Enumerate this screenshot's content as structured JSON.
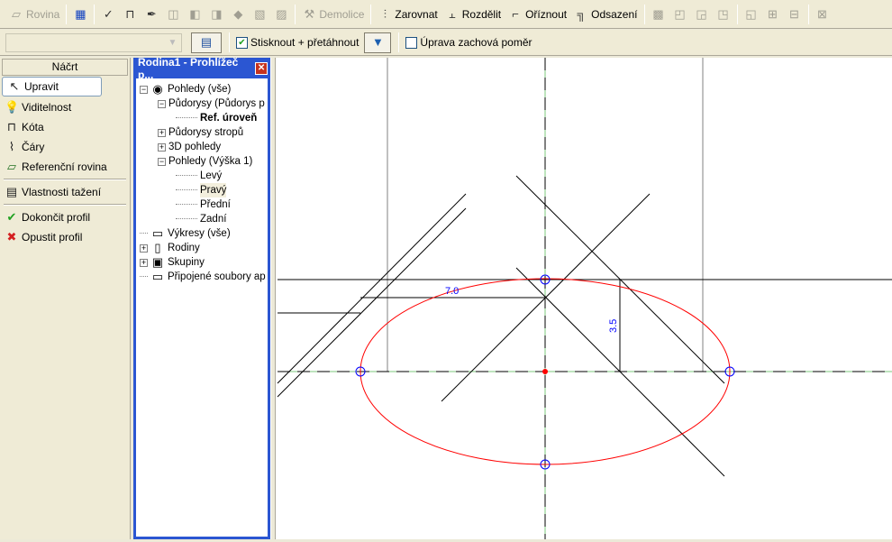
{
  "toolbar1": {
    "items": [
      {
        "label": "Rovina",
        "icon": "plane-icon",
        "disabled": true
      },
      {
        "label": "",
        "icon": "grid-icon"
      },
      {
        "label": "",
        "icon": "spellcheck-icon"
      },
      {
        "label": "",
        "icon": "dimension-icon"
      },
      {
        "label": "",
        "icon": "eyedropper-icon"
      },
      {
        "label": "",
        "icon": "cut-geometry-icon",
        "disabled": true
      },
      {
        "label": "",
        "icon": "join-icon",
        "disabled": true
      },
      {
        "label": "",
        "icon": "unjoin-icon",
        "disabled": true
      },
      {
        "label": "",
        "icon": "paint-icon",
        "disabled": true
      },
      {
        "label": "",
        "icon": "split-face-icon",
        "disabled": true
      },
      {
        "label": "",
        "icon": "pattern-icon",
        "disabled": true
      },
      {
        "label": "Demolice",
        "icon": "hammer-icon",
        "disabled": true
      },
      {
        "label": "Zarovnat",
        "icon": "align-icon"
      },
      {
        "label": "Rozdělit",
        "icon": "split-icon"
      },
      {
        "label": "Oříznout",
        "icon": "trim-icon"
      },
      {
        "label": "Odsazení",
        "icon": "offset-icon"
      },
      {
        "label": "",
        "icon": "copy-icon",
        "disabled": true
      },
      {
        "label": "",
        "icon": "rotate-icon",
        "disabled": true
      },
      {
        "label": "",
        "icon": "mirror-icon",
        "disabled": true
      },
      {
        "label": "",
        "icon": "array-icon",
        "disabled": true
      },
      {
        "label": "",
        "icon": "move-icon",
        "disabled": true
      },
      {
        "label": "",
        "icon": "scale-icon",
        "disabled": true
      },
      {
        "label": "",
        "icon": "pin-icon",
        "disabled": true
      },
      {
        "label": "",
        "icon": "unpin-icon",
        "disabled": true
      }
    ]
  },
  "toolbar2": {
    "type_selector_value": "",
    "press_drag_label": "Stisknout + přetáhnout",
    "press_drag_checked": true,
    "keep_ratio_label": "Úprava zachová poměr",
    "keep_ratio_checked": false
  },
  "sketch_panel": {
    "title": "Náčrt",
    "items": [
      {
        "label": "Upravit",
        "icon": "cursor-icon"
      },
      {
        "label": "Viditelnost",
        "icon": "lightbulb-icon"
      },
      {
        "label": "Kóta",
        "icon": "dimension-icon"
      },
      {
        "label": "Čáry",
        "icon": "lines-icon"
      },
      {
        "label": "Referenční rovina",
        "icon": "reference-plane-icon"
      },
      {
        "label": "Vlastnosti tažení",
        "icon": "properties-icon"
      },
      {
        "label": "Dokončit profil",
        "icon": "check-icon"
      },
      {
        "label": "Opustit profil",
        "icon": "cancel-icon"
      }
    ]
  },
  "browser": {
    "title": "Rodina1 - Prohlížeč p...",
    "tree": [
      {
        "label": "Pohledy (vše)",
        "level": 0,
        "toggle": "−",
        "icon": "eye-icon"
      },
      {
        "label": "Půdorysy (Půdorys p",
        "level": 1,
        "toggle": "−"
      },
      {
        "label": "Ref. úroveň",
        "level": 2,
        "bold": true
      },
      {
        "label": "Půdorysy stropů",
        "level": 1,
        "toggle": "+"
      },
      {
        "label": "3D pohledy",
        "level": 1,
        "toggle": "+"
      },
      {
        "label": "Pohledy (Výška 1)",
        "level": 1,
        "toggle": "−"
      },
      {
        "label": "Levý",
        "level": 2
      },
      {
        "label": "Pravý",
        "level": 2,
        "selected": true
      },
      {
        "label": "Přední",
        "level": 2
      },
      {
        "label": "Zadní",
        "level": 2
      },
      {
        "label": "Výkresy (vše)",
        "level": 0,
        "icon": "sheet-icon"
      },
      {
        "label": "Rodiny",
        "level": 0,
        "toggle": "+",
        "icon": "families-icon"
      },
      {
        "label": "Skupiny",
        "level": 0,
        "toggle": "+",
        "icon": "groups-icon"
      },
      {
        "label": "Připojené soubory ap",
        "level": 0,
        "icon": "link-icon"
      }
    ]
  },
  "canvas": {
    "dimensions": [
      "7.0",
      "3.5"
    ],
    "colors": {
      "ellipse": "#ff0000",
      "reference": "#7ec87e",
      "dimension": "#0000ff"
    }
  }
}
